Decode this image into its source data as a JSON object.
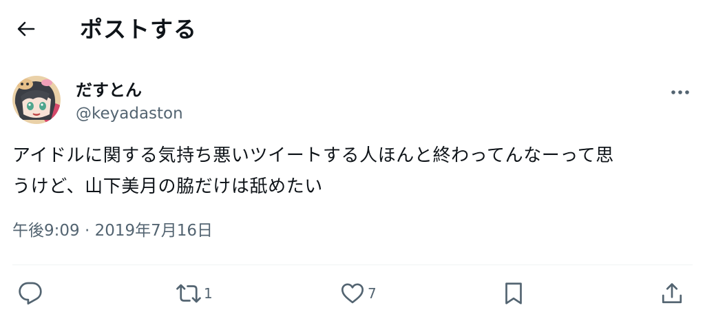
{
  "header": {
    "title": "ポストする"
  },
  "tweet": {
    "display_name": "だすとん",
    "handle": "@keyadaston",
    "text_line1": "アイドルに関する気持ち悪いツイートする人ほんと終わってんなーって思",
    "text_line2": "うけど、山下美月の脇だけは舐めたい",
    "timestamp": "午後9:09 · 2019年7月16日"
  },
  "actions": {
    "reply_icon": "reply-icon",
    "retweet_icon": "retweet-icon",
    "retweet_count": "1",
    "like_icon": "heart-icon",
    "like_count": "7",
    "bookmark_icon": "bookmark-icon",
    "share_icon": "share-icon"
  },
  "colors": {
    "text": "#0f1419",
    "secondary": "#536471",
    "divider": "#eff3f4"
  }
}
